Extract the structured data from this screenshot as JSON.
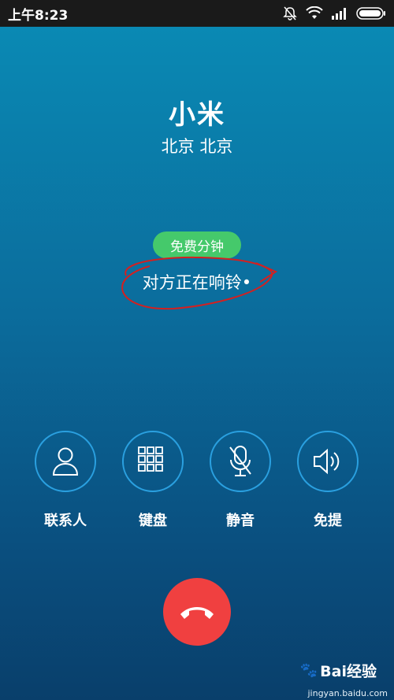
{
  "status_bar": {
    "time": "上午8:23",
    "icons": [
      "bell-off-icon",
      "wifi-icon",
      "signal-icon",
      "battery-icon"
    ]
  },
  "call": {
    "name": "小米",
    "location": "北京 北京",
    "badge": "免费分钟",
    "status": "对方正在响铃•"
  },
  "actions": [
    {
      "label": "联系人",
      "icon": "contact-icon"
    },
    {
      "label": "键盘",
      "icon": "keypad-icon"
    },
    {
      "label": "静音",
      "icon": "mic-off-icon"
    },
    {
      "label": "免提",
      "icon": "speaker-icon"
    }
  ],
  "hangup": {
    "icon": "hang-up-icon",
    "color": "#f04040"
  },
  "colors": {
    "accent_ring": "#2aa0e0",
    "badge": "#45c96b",
    "annotation": "#d42020"
  },
  "watermark": {
    "logo_text": "Bai经验",
    "domain": "jingyan.baidu.com"
  }
}
